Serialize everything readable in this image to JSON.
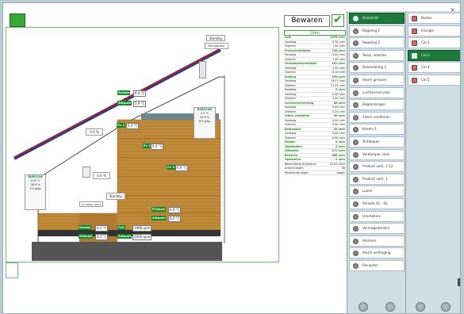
{
  "window": {
    "close_glyph": "×",
    "save_label": "Bewaren"
  },
  "hours": {
    "title": "Uren",
    "rows": [
      {
        "l": "Lofk",
        "v": "1055 uren",
        "sec": true
      },
      {
        "l": "Vandaag",
        "v": "0.30 uren"
      },
      {
        "l": "Gisteren",
        "v": "1.20 uren"
      },
      {
        "l": "Productventilator",
        "v": "765 uren",
        "sec": true
      },
      {
        "l": "Vandaag",
        "v": "0.00 uren"
      },
      {
        "l": "Gisteren",
        "v": "1.40 uren"
      },
      {
        "l": "Verdampersventilator",
        "v": "461 uren",
        "sec": true
      },
      {
        "l": "Vandaag",
        "v": "4.50 uren"
      },
      {
        "l": "Gisteren",
        "v": "6.10 uren"
      },
      {
        "l": "Koeling",
        "v": "399 uren",
        "sec": true
      },
      {
        "l": "Vandaag",
        "v": "19.07 uren"
      },
      {
        "l": "Gisteren",
        "v": "21.57 uren"
      },
      {
        "l": "Kachels",
        "v": "0 uren",
        "sec": true
      },
      {
        "l": "Vandaag",
        "v": "0.00 uren"
      },
      {
        "l": "Gisteren",
        "v": "0.00 uren"
      },
      {
        "l": "Luchtververversing",
        "v": "86 uren",
        "sec": true
      },
      {
        "l": "Vandaag",
        "v": "0.00 uren"
      },
      {
        "l": "Gisteren",
        "v": "0.20 uren"
      },
      {
        "l": "Intern ventileren",
        "v": "90 uren",
        "sec": true
      },
      {
        "l": "Vandaag",
        "v": "0.00 uren"
      },
      {
        "l": "Gisteren",
        "v": "0.00 uren"
      },
      {
        "l": "Bedrewens",
        "v": "36 uren",
        "sec": true
      },
      {
        "l": "Vandaag",
        "v": "0.00 uren"
      },
      {
        "l": "Gisteren",
        "v": "0.00 uren"
      },
      {
        "l": "Drogen",
        "v": "0 uren",
        "sec": true
      },
      {
        "l": "Wondkuilen",
        "v": "0 uren",
        "sec": true
      },
      {
        "l": "Uitkoelen",
        "v": "271 uren",
        "sec": true
      },
      {
        "l": "Bewaren",
        "v": "386 uren",
        "sec": true
      },
      {
        "l": "Opwarmen",
        "v": "0 uren",
        "sec": true
      },
      {
        "l": "Behandeling startdatum",
        "v": "02-03-2022"
      },
      {
        "l": "Actieve dagen",
        "v": "98"
      },
      {
        "l": "Resterende dagen",
        "v": "dagen"
      }
    ]
  },
  "menu_main": {
    "items": [
      {
        "label": "Overzicht",
        "selected": true
      },
      {
        "label": "Regeling 1"
      },
      {
        "label": "Regeling 2"
      },
      {
        "label": "Temp. selectie"
      },
      {
        "label": "Behandeling 1"
      },
      {
        "label": "Alarm grenzen"
      },
      {
        "label": "Luchtververvsen"
      },
      {
        "label": "Begrenzingen"
      },
      {
        "label": "Intern ventileren"
      },
      {
        "label": "Koelen 1"
      },
      {
        "label": "Ontdooien"
      },
      {
        "label": "Verdamper vent."
      },
      {
        "label": "Product verk. 1-12"
      },
      {
        "label": "Product verk. 1"
      },
      {
        "label": "Luken"
      },
      {
        "label": "Periode 01 - 02"
      },
      {
        "label": "Urentellers"
      },
      {
        "label": "Vermogentellers"
      },
      {
        "label": "Alarmen"
      },
      {
        "label": "Alarm vertraging"
      },
      {
        "label": "Recepten"
      }
    ],
    "nav": [
      "‹",
      "›"
    ]
  },
  "menu_cells": {
    "items": [
      {
        "label": "Buiten"
      },
      {
        "label": "Energie"
      },
      {
        "label": "Cel 2"
      },
      {
        "label": "Cel 3",
        "selected": true
      },
      {
        "label": "Cel 4"
      },
      {
        "label": "Cel 5"
      }
    ],
    "nav": [
      "‹",
      "›"
    ]
  },
  "drawing": {
    "standby_top": "Standby",
    "mechanisch": "Mechanisch",
    "pct1": "0.0 %",
    "pct2": "0.0 %",
    "standby_mid": "Standby",
    "ruimte_label": "Ruimte",
    "instelpunt_label": "Setpunt",
    "ruimte_val": "6.0 °C",
    "instelpunt_val": "5.9 °C",
    "sensor_right": {
      "name": "BUBSCAN",
      "temp": "4.4 °C",
      "rh": "95.8 %",
      "ah": "6.5 g/kg"
    },
    "sensor_left": {
      "name": "BUBSCAN",
      "temp": "13.6 °C",
      "rh": "98.8 %",
      "ah": "9.5 g/kg"
    },
    "t1_label": "Pr. 1",
    "t1_val": "6.4 °C",
    "t2_label": "Pr. 2",
    "t2_val": "6.4 °C",
    "t3_label": "Pr. 3",
    "t3_val": "6.6 °C",
    "product_label": "Product",
    "product_val": "6.0 °C",
    "setpunt_label": "Setpunt",
    "setpunt_val": "6.0 °C",
    "kanaal_label": "Kanaal",
    "kanaal_val": "6.3 °C",
    "setpunt2_label": "Setpunt",
    "setpunt2_val": "6.5 °C",
    "co2_label": "Co2",
    "co2_val": "1988 ppm",
    "setpunt3_label": "Setpunt",
    "setpunt3_val": "2000 ppm",
    "flow_label": "Luchtklep status"
  },
  "colors": {
    "accent": "#138a2a",
    "wood": "#c08a3a",
    "roof": "#3a3a7a"
  }
}
